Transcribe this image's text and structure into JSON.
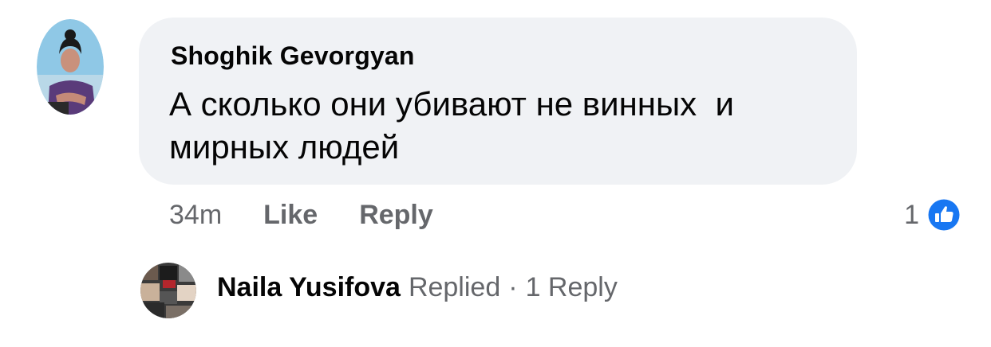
{
  "comment": {
    "author": "Shoghik Gevorgyan",
    "text": "А сколько они убивают не винных  и мирных людей",
    "timestamp": "34m",
    "like_label": "Like",
    "reply_label": "Reply",
    "reaction_count": "1",
    "reaction_icon": "like-thumbs-up-icon",
    "bubble_color": "#f0f2f5",
    "reaction_color": "#1877f2"
  },
  "reply_summary": {
    "name": "Naila Yusifova",
    "action": "Replied",
    "separator": "·",
    "count_label": "1 Reply"
  }
}
